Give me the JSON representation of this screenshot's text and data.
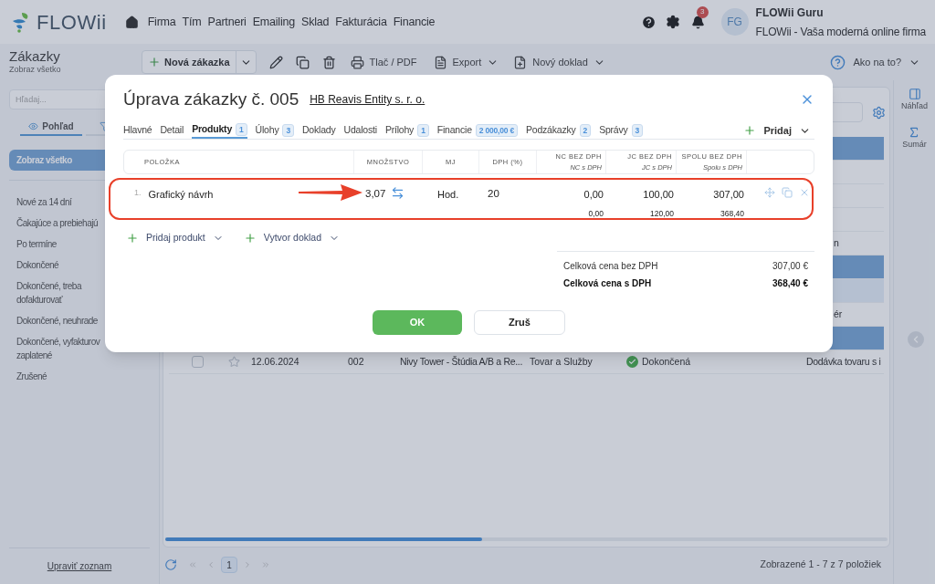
{
  "nav": {
    "logo": "FLOWii",
    "menu": [
      "Firma",
      "Tím",
      "Partneri",
      "Emailing",
      "Sklad",
      "Fakturácia",
      "Financie"
    ],
    "notifications": "3",
    "avatar": "FG",
    "user_name": "FLOWii Guru",
    "company": "FLOWii - Vaša moderná online firma"
  },
  "toolbar": {
    "title": "Zákazky",
    "subtitle": "Zobraz všetko",
    "new_button": "Nová zákazka",
    "print": "Tlač / PDF",
    "export": "Export",
    "new_document": "Nový doklad",
    "help": "Ako na to?"
  },
  "sidebar": {
    "search_placeholder": "Hľadaj...",
    "view_tabs": [
      {
        "kind": "view",
        "label": "Pohľad",
        "selected": true
      },
      {
        "kind": "filter",
        "selected": false
      }
    ],
    "items": [
      {
        "label": "Zobraz všetko",
        "selected": true
      },
      {
        "label": "Nové za 14 dní",
        "selected": false
      },
      {
        "label": "Čakajúce a prebiehajú",
        "selected": false
      },
      {
        "label": "Po termíne",
        "selected": false
      },
      {
        "label": "Dokončené",
        "selected": false
      },
      {
        "label": "Dokončené, treba\ndofakturovať",
        "selected": false
      },
      {
        "label": "Dokončené, neuhrade",
        "selected": false
      },
      {
        "label": "Dokončené, vyfakturov\nzaplatené",
        "selected": false
      },
      {
        "label": "Zrušené",
        "selected": false
      }
    ],
    "edit_list": "Upraviť zoznam"
  },
  "table": {
    "rows": [
      {
        "selected": true,
        "hovered": false
      },
      {
        "selected": false,
        "hovered": false
      },
      {
        "selected": false,
        "hovered": false
      },
      {
        "selected": false,
        "hovered": false
      },
      {
        "selected": false,
        "hovered": false,
        "fragment": "n"
      },
      {
        "selected": true,
        "hovered": false
      },
      {
        "selected": false,
        "hovered": true
      },
      {
        "selected": false,
        "hovered": false,
        "fragment": "ér"
      },
      {
        "selected": true,
        "hovered": false
      },
      {
        "selected": false,
        "hovered": false,
        "checked": false,
        "starred": false,
        "date": "12.06.2024",
        "number": "002",
        "name": "Nivy Tower - Štúdia A/B a Re...",
        "type": "Tovar a Služby",
        "status": "Dokončená",
        "description": "Dodávka tovaru s i"
      }
    ]
  },
  "pagination": {
    "pages": [
      {
        "label": "1",
        "selected": true
      }
    ],
    "summary": "Zobrazené 1 - 7 z 7 položiek"
  },
  "right_panel": [
    {
      "kind": "preview",
      "label": "Náhľad"
    },
    {
      "kind": "summary",
      "label": "Sumár"
    }
  ],
  "modal": {
    "title": "Úprava zákazky č. 005",
    "customer": "HB Reavis Entity s. r. o.",
    "tabs": [
      {
        "label": "Hlavné",
        "selected": false
      },
      {
        "label": "Detail",
        "selected": false
      },
      {
        "label": "Produkty",
        "badge": "1",
        "selected": true
      },
      {
        "label": "Úlohy",
        "badge": "3",
        "selected": false
      },
      {
        "label": "Doklady",
        "selected": false
      },
      {
        "label": "Udalosti",
        "selected": false
      },
      {
        "label": "Prílohy",
        "badge": "1",
        "selected": false
      },
      {
        "label": "Financie",
        "badge": "2 000,00 €",
        "selected": false
      },
      {
        "label": "Podzákazky",
        "badge": "2",
        "selected": false
      },
      {
        "label": "Správy",
        "badge": "3",
        "selected": false
      }
    ],
    "add": "Pridaj",
    "columns": [
      {
        "label": "POLOŽKA"
      },
      {
        "label": "MNOŽSTVO"
      },
      {
        "label": "MJ"
      },
      {
        "label": "DPH (%)"
      },
      {
        "label": "NC BEZ DPH",
        "sublabel": "NC s DPH"
      },
      {
        "label": "JC BEZ DPH",
        "sublabel": "JC s DPH"
      },
      {
        "label": "SPOLU BEZ DPH",
        "sublabel": "Spolu s DPH"
      }
    ],
    "items": [
      {
        "index": "1.",
        "name": "Grafický návrh",
        "quantity": "3,07",
        "unit": "Hod.",
        "vat": "20",
        "nc": "0,00",
        "nc_vat": "0,00",
        "jc": "100,00",
        "jc_vat": "120,00",
        "total": "307,00",
        "total_vat": "368,40"
      }
    ],
    "add_product": "Pridaj produkt",
    "create_document": "Vytvor doklad",
    "totals": [
      {
        "label": "Celková cena bez DPH",
        "value": "307,00 €",
        "bold": false
      },
      {
        "label": "Celková cena s DPH",
        "value": "368,40 €",
        "bold": true
      }
    ],
    "ok": "OK",
    "cancel": "Zruš"
  }
}
